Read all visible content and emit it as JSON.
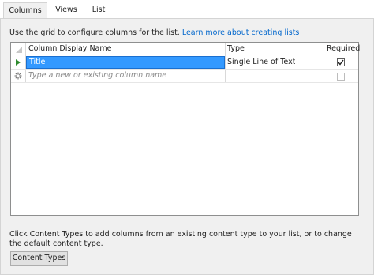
{
  "tabs": [
    {
      "label": "Columns",
      "active": true
    },
    {
      "label": "Views",
      "active": false
    },
    {
      "label": "List",
      "active": false
    }
  ],
  "intro": {
    "text": "Use the grid to configure columns for the list.",
    "link": "Learn more about creating lists"
  },
  "grid": {
    "headers": {
      "name": "Column Display Name",
      "type": "Type",
      "required": "Required"
    },
    "rows": [
      {
        "name": "Title",
        "type": "Single Line of Text",
        "required": true,
        "selected": true
      }
    ],
    "new_row_placeholder": "Type a new or existing column name"
  },
  "footer": {
    "text": "Click Content Types to add columns from an existing content type to your list, or to change the default content type.",
    "button": "Content Types"
  },
  "colors": {
    "selection": "#3399ff",
    "link": "#0066cc",
    "row_indicator": "#2e8b2e"
  },
  "icons": {
    "current_row": "triangle-right-icon",
    "new_row": "gear-icon",
    "corner": "corner-triangle-icon"
  }
}
